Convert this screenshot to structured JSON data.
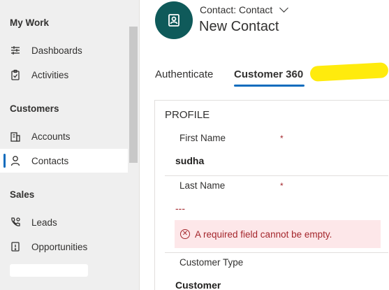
{
  "sidebar": {
    "groups": [
      {
        "title": "My Work",
        "items": [
          {
            "label": "Dashboards",
            "icon": "dashboard-icon"
          },
          {
            "label": "Activities",
            "icon": "clipboard-icon"
          }
        ]
      },
      {
        "title": "Customers",
        "items": [
          {
            "label": "Accounts",
            "icon": "building-icon"
          },
          {
            "label": "Contacts",
            "icon": "person-icon",
            "active": true
          }
        ]
      },
      {
        "title": "Sales",
        "items": [
          {
            "label": "Leads",
            "icon": "phone-icon"
          },
          {
            "label": "Opportunities",
            "icon": "opportunity-icon"
          }
        ]
      }
    ]
  },
  "header": {
    "entity": "Contact: Contact",
    "title": "New Contact"
  },
  "tabs": [
    {
      "label": "Authenticate"
    },
    {
      "label": "Customer 360",
      "active": true
    }
  ],
  "form": {
    "section_title": "PROFILE",
    "first_name_label": "First Name",
    "first_name_value": "sudha",
    "last_name_label": "Last Name",
    "last_name_value": "---",
    "required_mark": "*",
    "error_message": "A required field cannot be empty.",
    "customer_type_label": "Customer Type",
    "customer_type_value": "Customer"
  },
  "colors": {
    "accent": "#0f6cbd",
    "avatar": "#0f5a5a",
    "error": "#a4262c",
    "error_bg": "#fde7e9",
    "highlight": "#ffea00"
  }
}
